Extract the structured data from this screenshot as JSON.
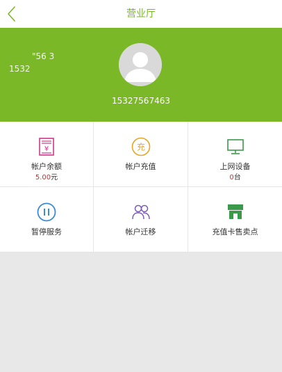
{
  "header": {
    "title": "营业厅"
  },
  "profile": {
    "ghost_line1": "\"56 3",
    "ghost_line2": "1532",
    "phone": "15327567463"
  },
  "menu": [
    {
      "label": "帐户余额",
      "value_num": "5.00",
      "value_unit": "元",
      "icon": "balance-doc-icon",
      "color": "#d0368c"
    },
    {
      "label": "帐户充值",
      "icon": "recharge-coin-icon",
      "color": "#e8a524"
    },
    {
      "label": "上网设备",
      "value_num": "0",
      "value_unit": "台",
      "icon": "monitor-icon",
      "color": "#3a9a4a"
    },
    {
      "label": "暂停服务",
      "icon": "pause-circle-icon",
      "color": "#3a8ad6"
    },
    {
      "label": "帐户迁移",
      "icon": "users-icon",
      "color": "#7a5ab8"
    },
    {
      "label": "充值卡售卖点",
      "icon": "store-icon",
      "color": "#3a9a4a"
    }
  ],
  "colors": {
    "brand": "#7ab828",
    "red": "#e52525"
  }
}
